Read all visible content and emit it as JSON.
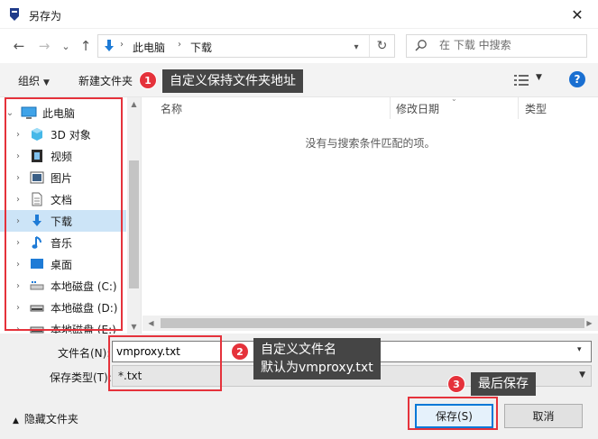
{
  "window": {
    "title": "另存为",
    "close_symbol": "✕"
  },
  "nav": {
    "back": "←",
    "forward": "→",
    "recent": "⌄",
    "up": "↑"
  },
  "address": {
    "crumbs": [
      "此电脑",
      "下载"
    ],
    "separator": "›"
  },
  "search": {
    "placeholder": "在 下载 中搜索"
  },
  "toolbar": {
    "organize_label": "组织",
    "new_folder_label": "新建文件夹"
  },
  "tree": {
    "items": [
      {
        "label": "此电脑",
        "icon": "computer-icon"
      },
      {
        "label": "3D 对象",
        "icon": "cube-icon"
      },
      {
        "label": "视频",
        "icon": "video-icon"
      },
      {
        "label": "图片",
        "icon": "picture-icon"
      },
      {
        "label": "文档",
        "icon": "document-icon"
      },
      {
        "label": "下载",
        "icon": "download-icon"
      },
      {
        "label": "音乐",
        "icon": "music-icon"
      },
      {
        "label": "桌面",
        "icon": "desktop-icon"
      },
      {
        "label": "本地磁盘 (C:)",
        "icon": "drive-icon"
      },
      {
        "label": "本地磁盘 (D:)",
        "icon": "drive-icon"
      },
      {
        "label": "本地磁盘 (E:)",
        "icon": "drive-icon"
      }
    ],
    "selected_index": 5
  },
  "file_list": {
    "columns": [
      "名称",
      "修改日期",
      "类型"
    ],
    "empty_message": "没有与搜索条件匹配的项。"
  },
  "form": {
    "filename_label": "文件名(N):",
    "filename_value": "vmproxy.txt",
    "filetype_label": "保存类型(T):",
    "filetype_value": "*.txt"
  },
  "footer": {
    "hide_folders_label": "隐藏文件夹",
    "save_label": "保存(S)",
    "cancel_label": "取消"
  },
  "annotations": {
    "badges": [
      "1",
      "2",
      "3"
    ],
    "callout1": "自定义保持文件夹地址",
    "callout2_line1": "自定义文件名",
    "callout2_line2": "默认为vmproxy.txt",
    "callout3": "最后保存"
  },
  "colors": {
    "highlight": "#e5323b",
    "callout_bg": "#454545",
    "accent": "#0078d7",
    "selection": "#cce4f7"
  }
}
